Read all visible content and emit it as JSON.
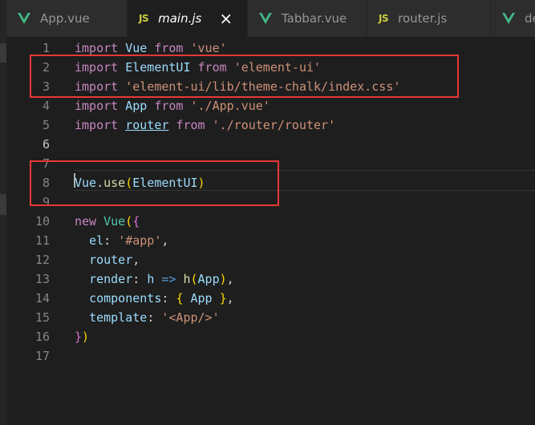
{
  "tabs": [
    {
      "label": "App.vue",
      "icon": "vue-icon",
      "active": false
    },
    {
      "label": "main.js",
      "icon": "js-icon",
      "active": true
    },
    {
      "label": "Tabbar.vue",
      "icon": "vue-icon",
      "active": false
    },
    {
      "label": "router.js",
      "icon": "js-icon",
      "active": false
    },
    {
      "label": "de",
      "icon": "vue-icon",
      "active": false
    }
  ],
  "icons": {
    "js": "JS",
    "close": "×"
  },
  "colors": {
    "vue": "#42b883",
    "js": "#cbcb41",
    "highlight_box": "#e53935"
  },
  "editor": {
    "current_line": 6,
    "lines": [
      {
        "n": "1",
        "tokens": [
          {
            "t": "import",
            "c": "kw"
          },
          {
            "t": " "
          },
          {
            "t": "Vue",
            "c": "id"
          },
          {
            "t": " "
          },
          {
            "t": "from",
            "c": "kw"
          },
          {
            "t": " "
          },
          {
            "t": "'vue'",
            "c": "str"
          }
        ]
      },
      {
        "n": "2",
        "tokens": [
          {
            "t": "import",
            "c": "kw"
          },
          {
            "t": " "
          },
          {
            "t": "ElementUI",
            "c": "id"
          },
          {
            "t": " "
          },
          {
            "t": "from",
            "c": "kw"
          },
          {
            "t": " "
          },
          {
            "t": "'element-ui'",
            "c": "str"
          }
        ]
      },
      {
        "n": "3",
        "tokens": [
          {
            "t": "import",
            "c": "kw"
          },
          {
            "t": " "
          },
          {
            "t": "'element-ui/lib/theme-chalk/index.css'",
            "c": "str"
          }
        ]
      },
      {
        "n": "4",
        "tokens": [
          {
            "t": "import",
            "c": "kw"
          },
          {
            "t": " "
          },
          {
            "t": "App",
            "c": "id"
          },
          {
            "t": " "
          },
          {
            "t": "from",
            "c": "kw"
          },
          {
            "t": " "
          },
          {
            "t": "'./App.vue'",
            "c": "str"
          }
        ]
      },
      {
        "n": "5",
        "tokens": [
          {
            "t": "import",
            "c": "kw"
          },
          {
            "t": " "
          },
          {
            "t": "router",
            "c": "link"
          },
          {
            "t": " "
          },
          {
            "t": "from",
            "c": "kw"
          },
          {
            "t": " "
          },
          {
            "t": "'./router/router'",
            "c": "str"
          }
        ]
      },
      {
        "n": "6",
        "tokens": []
      },
      {
        "n": "7",
        "tokens": []
      },
      {
        "n": "8",
        "tokens": [
          {
            "t": "Vue",
            "c": "id"
          },
          {
            "t": ".",
            "c": "punct"
          },
          {
            "t": "use",
            "c": "fn"
          },
          {
            "t": "(",
            "c": "br1"
          },
          {
            "t": "ElementUI",
            "c": "id"
          },
          {
            "t": ")",
            "c": "br1"
          }
        ]
      },
      {
        "n": "9",
        "tokens": []
      },
      {
        "n": "10",
        "tokens": [
          {
            "t": "new",
            "c": "kw"
          },
          {
            "t": " "
          },
          {
            "t": "Vue",
            "c": "cls"
          },
          {
            "t": "(",
            "c": "br1"
          },
          {
            "t": "{",
            "c": "br2"
          }
        ]
      },
      {
        "n": "11",
        "tokens": [
          {
            "t": "  "
          },
          {
            "t": "el",
            "c": "id"
          },
          {
            "t": ": ",
            "c": "punct"
          },
          {
            "t": "'#app'",
            "c": "str"
          },
          {
            "t": ",",
            "c": "punct"
          }
        ]
      },
      {
        "n": "12",
        "tokens": [
          {
            "t": "  "
          },
          {
            "t": "router",
            "c": "id"
          },
          {
            "t": ",",
            "c": "punct"
          }
        ]
      },
      {
        "n": "13",
        "tokens": [
          {
            "t": "  "
          },
          {
            "t": "render",
            "c": "id"
          },
          {
            "t": ": ",
            "c": "punct"
          },
          {
            "t": "h",
            "c": "id"
          },
          {
            "t": " "
          },
          {
            "t": "=>",
            "c": "arrow"
          },
          {
            "t": " "
          },
          {
            "t": "h",
            "c": "fn"
          },
          {
            "t": "(",
            "c": "br1"
          },
          {
            "t": "App",
            "c": "id"
          },
          {
            "t": ")",
            "c": "br1"
          },
          {
            "t": ",",
            "c": "punct"
          }
        ]
      },
      {
        "n": "14",
        "tokens": [
          {
            "t": "  "
          },
          {
            "t": "components",
            "c": "id"
          },
          {
            "t": ": ",
            "c": "punct"
          },
          {
            "t": "{",
            "c": "br1"
          },
          {
            "t": " "
          },
          {
            "t": "App",
            "c": "id"
          },
          {
            "t": " "
          },
          {
            "t": "}",
            "c": "br1"
          },
          {
            "t": ",",
            "c": "punct"
          }
        ]
      },
      {
        "n": "15",
        "tokens": [
          {
            "t": "  "
          },
          {
            "t": "template",
            "c": "id"
          },
          {
            "t": ": ",
            "c": "punct"
          },
          {
            "t": "'<App/>'",
            "c": "str"
          }
        ]
      },
      {
        "n": "16",
        "tokens": [
          {
            "t": "}",
            "c": "br2"
          },
          {
            "t": ")",
            "c": "br1"
          }
        ]
      },
      {
        "n": "17",
        "tokens": []
      }
    ]
  }
}
